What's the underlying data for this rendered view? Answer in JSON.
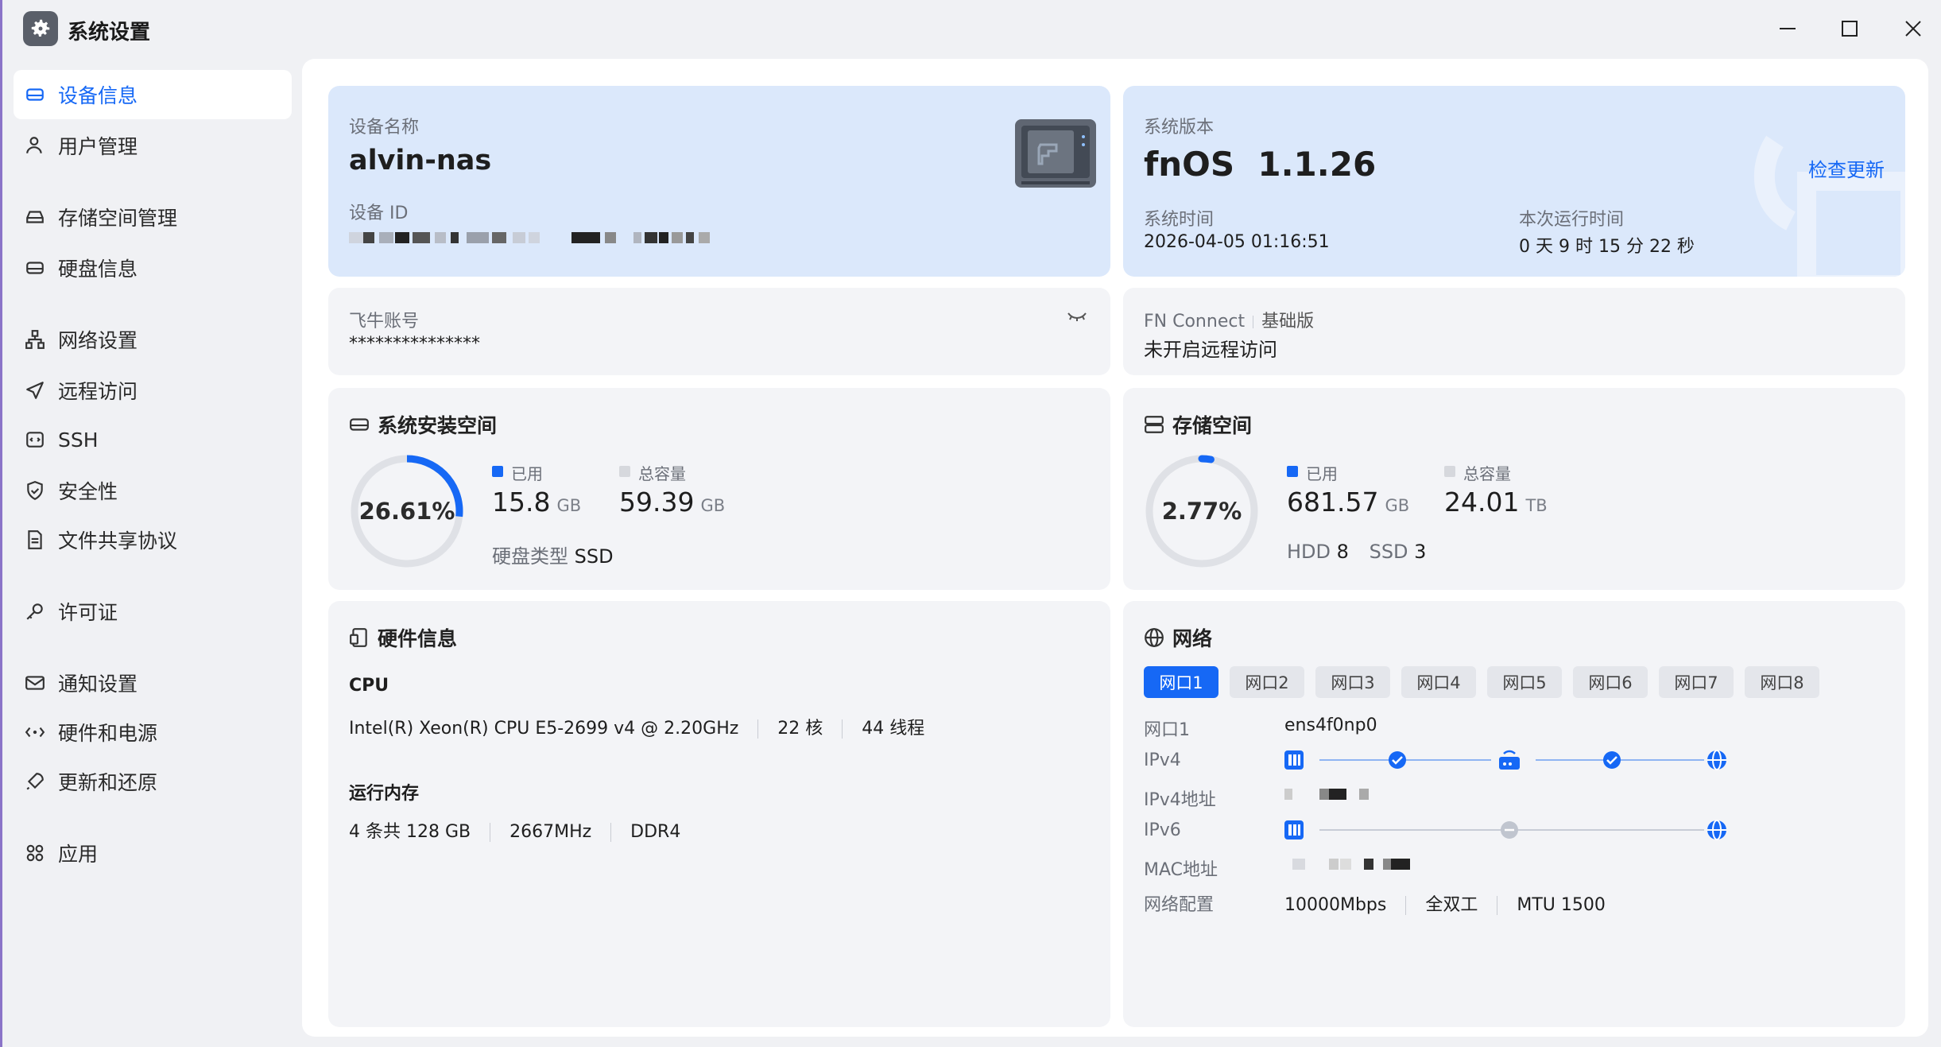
{
  "app": {
    "title": "系统设置"
  },
  "sidebar": {
    "items": [
      {
        "label": "设备信息",
        "icon": "device-icon",
        "active": true
      },
      {
        "label": "用户管理",
        "icon": "user-icon"
      },
      {
        "label": "存储空间管理",
        "icon": "storage-icon"
      },
      {
        "label": "硬盘信息",
        "icon": "disk-icon"
      },
      {
        "label": "网络设置",
        "icon": "network-icon"
      },
      {
        "label": "远程访问",
        "icon": "send-icon"
      },
      {
        "label": "SSH",
        "icon": "terminal-icon"
      },
      {
        "label": "安全性",
        "icon": "shield-icon"
      },
      {
        "label": "文件共享协议",
        "icon": "document-icon"
      },
      {
        "label": "许可证",
        "icon": "key-icon"
      },
      {
        "label": "通知设置",
        "icon": "mail-icon"
      },
      {
        "label": "硬件和电源",
        "icon": "power-icon"
      },
      {
        "label": "更新和还原",
        "icon": "rocket-icon"
      },
      {
        "label": "应用",
        "icon": "apps-icon"
      }
    ]
  },
  "device": {
    "name_label": "设备名称",
    "name": "alvin-nas",
    "id_label": "设备 ID"
  },
  "system": {
    "version_label": "系统版本",
    "version": "fnOS  1.1.26",
    "check_update": "检查更新",
    "time_label": "系统时间",
    "time": "2026-04-05 01:16:51",
    "uptime_label": "本次运行时间",
    "uptime": "0 天 9 时 15 分 22 秒"
  },
  "account": {
    "label": "飞牛账号",
    "value": "***************"
  },
  "fnconnect": {
    "label": "FN Connect",
    "edition": "基础版",
    "status": "未开启远程访问"
  },
  "system_space": {
    "title": "系统安装空间",
    "percent_text": "26.61%",
    "percent": 26.61,
    "used_label": "已用",
    "used": "15.8",
    "used_unit": "GB",
    "total_label": "总容量",
    "total": "59.39",
    "total_unit": "GB",
    "disk_type_label": "硬盘类型",
    "disk_type": "SSD"
  },
  "storage": {
    "title": "存储空间",
    "percent_text": "2.77%",
    "percent": 2.77,
    "used_label": "已用",
    "used": "681.57",
    "used_unit": "GB",
    "total_label": "总容量",
    "total": "24.01",
    "total_unit": "TB",
    "hdd_label": "HDD",
    "hdd": "8",
    "ssd_label": "SSD",
    "ssd": "3"
  },
  "hardware": {
    "title": "硬件信息",
    "cpu_label": "CPU",
    "cpu_model": "Intel(R) Xeon(R) CPU E5-2699 v4 @ 2.20GHz",
    "cpu_cores": "22 核",
    "cpu_threads": "44 线程",
    "mem_label": "运行内存",
    "mem_size": "4 条共 128 GB",
    "mem_freq": "2667MHz",
    "mem_type": "DDR4"
  },
  "network": {
    "title": "网络",
    "tabs": [
      "网口1",
      "网口2",
      "网口3",
      "网口4",
      "网口5",
      "网口6",
      "网口7",
      "网口8"
    ],
    "port_label": "网口1",
    "port_name": "ens4f0np0",
    "ipv4_label": "IPv4",
    "ipv4_addr_label": "IPv4地址",
    "ipv6_label": "IPv6",
    "mac_label": "MAC地址",
    "config_label": "网络配置",
    "speed": "10000Mbps",
    "duplex": "全双工",
    "mtu": "MTU 1500"
  },
  "colors": {
    "accent": "#1668f5",
    "card": "#f3f4f7",
    "card_blue": "#dbe8fb"
  }
}
